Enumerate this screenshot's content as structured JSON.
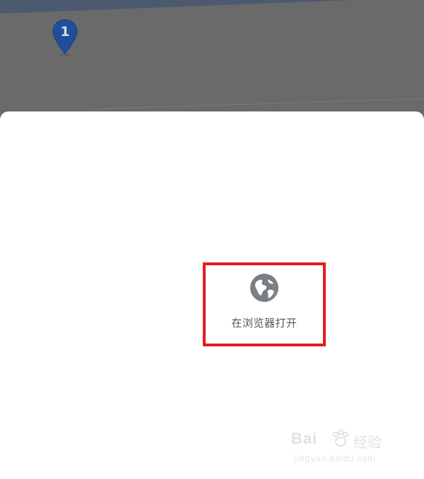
{
  "map": {
    "marker_number": "1"
  },
  "share_sheet": {
    "open_in_browser_label": "在浏览器打开",
    "icon": "globe-icon"
  },
  "watermark": {
    "logo_text": "Bai",
    "brand_text": "经验",
    "url": "jingyan.baidu.com"
  },
  "colors": {
    "highlight_border": "#e41b23",
    "icon_gray": "#7a7f86",
    "marker_blue": "#1f4f9a"
  }
}
